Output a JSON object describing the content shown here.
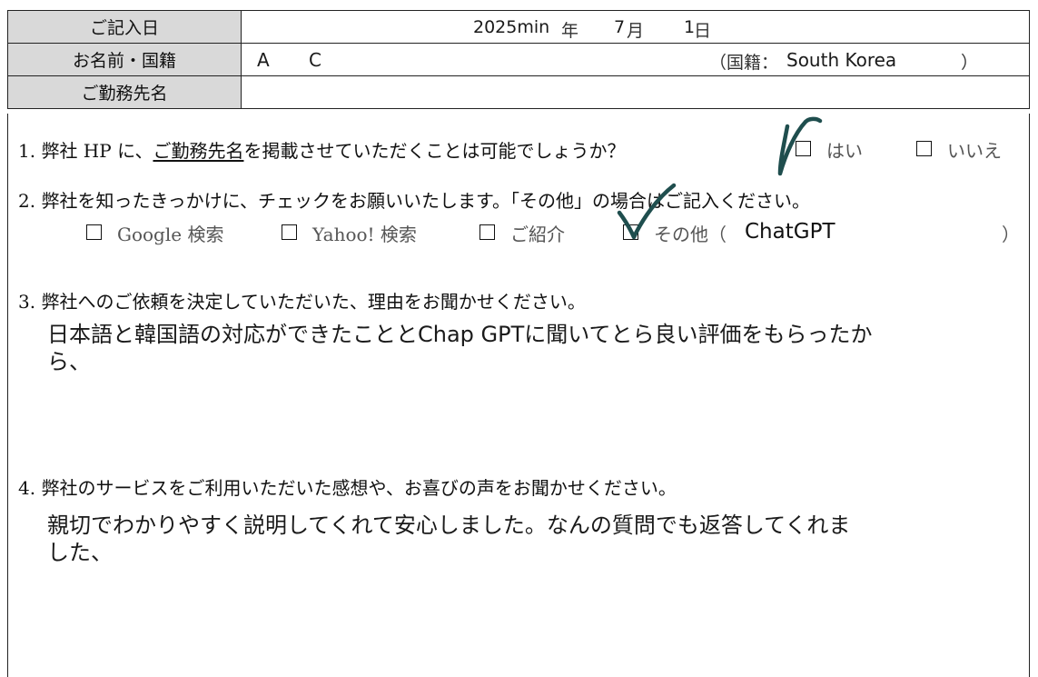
{
  "header": {
    "date_label": "ご記入日",
    "date_year": "2025min",
    "date_year_unit": "年",
    "date_month": "7",
    "date_month_unit": "月",
    "date_day": "1",
    "date_day_unit": "日",
    "name_label": "お名前・国籍",
    "name_first": "A",
    "name_last": "C",
    "nationality_label": "（国籍：",
    "nationality_value": "South Korea",
    "nationality_close": "）",
    "company_label": "ご勤務先名",
    "company_value": ""
  },
  "q1": {
    "num": "1.",
    "text_a": "弊社 HP に、",
    "text_underlined": "ご勤務先名",
    "text_b": "を掲載させていただくことは可能でしょうか？",
    "option_yes": "はい",
    "option_no": "いいえ",
    "checked": "はい"
  },
  "q2": {
    "num": "2.",
    "text": "弊社を知ったきっかけに、チェックをお願いいたします。「その他」の場合はご記入ください。",
    "options": [
      "Google 検索",
      "Yahoo!  検索",
      "ご紹介",
      "その他（"
    ],
    "other_close": "）",
    "other_value": "ChatGPT",
    "checked": "その他"
  },
  "q3": {
    "num": "3.",
    "text": "弊社へのご依頼を決定していただいた、理由をお聞かせください。",
    "answer_line1": "日本語と韓国語の対応ができたこととChap GPTに聞いてとら良い評価をもらったか",
    "answer_line2": "ら、"
  },
  "q4": {
    "num": "4.",
    "text": "弊社のサービスをご利用いただいた感想や、お喜びの声をお聞かせください。",
    "answer_line1": "親切でわかりやすく説明してくれて安心しました。なんの質問でも返答してくれま",
    "answer_line2": "した、"
  },
  "colors": {
    "label_bg": "#d9d9d9",
    "border": "#222222",
    "check_ink": "#1f4e4e"
  }
}
